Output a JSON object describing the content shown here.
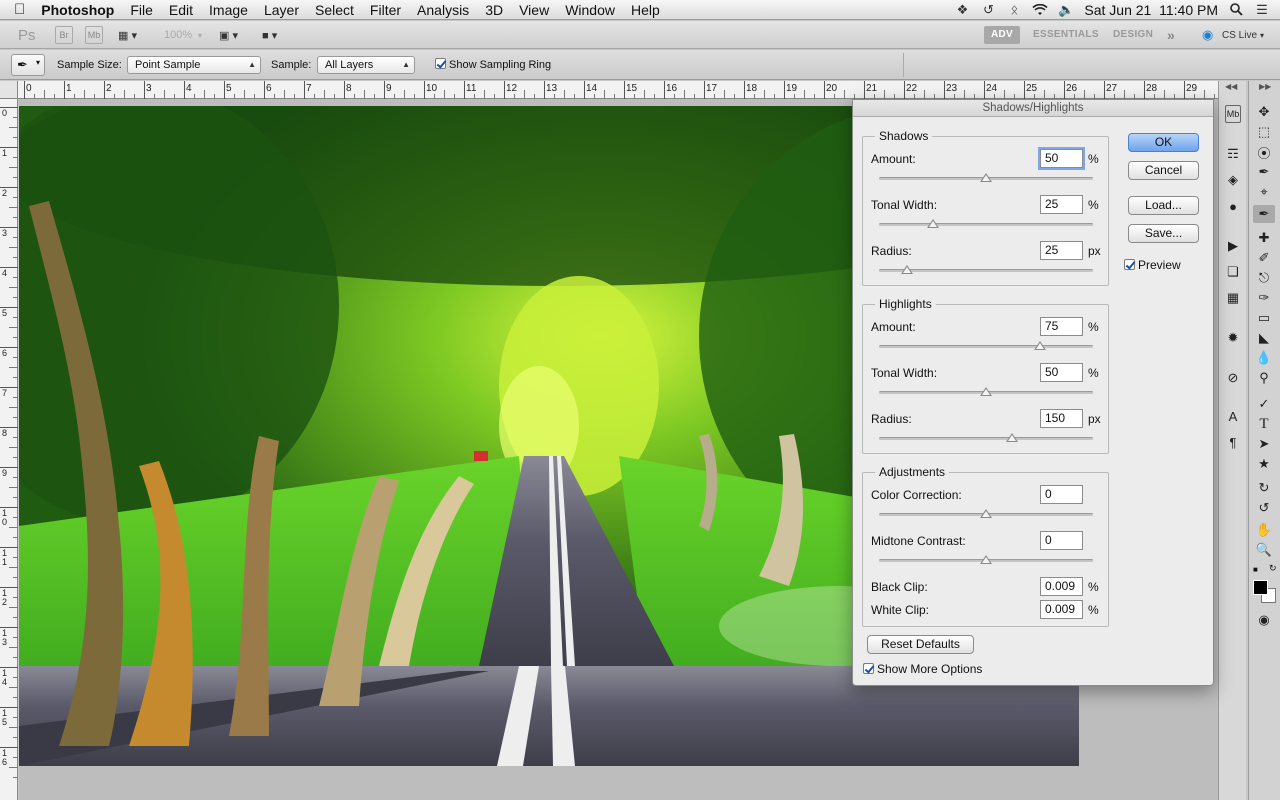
{
  "menubar": {
    "app_name": "Photoshop",
    "menus": [
      "File",
      "Edit",
      "Image",
      "Layer",
      "Select",
      "Filter",
      "Analysis",
      "3D",
      "View",
      "Window",
      "Help"
    ],
    "clock": "Sat Jun 21  11:40 PM",
    "icons": [
      "apple-icon",
      "dropbox-icon",
      "time-machine-icon",
      "bluetooth-icon",
      "wifi-icon",
      "volume-icon",
      "search-icon",
      "list-icon"
    ]
  },
  "appbar": {
    "ps_label": "Ps",
    "br_label": "Br",
    "mb_label": "Mb",
    "zoom": "100%",
    "workspaces": [
      "ADV",
      "ESSENTIALS",
      "DESIGN"
    ],
    "more": "»",
    "cs_live": "CS Live"
  },
  "options": {
    "sample_size_label": "Sample Size:",
    "sample_size_value": "Point Sample",
    "sample_label": "Sample:",
    "sample_value": "All Layers",
    "show_ring_label": "Show Sampling Ring",
    "show_ring_checked": true
  },
  "ruler": {
    "h_numbers": [
      "0",
      "1",
      "2",
      "3",
      "4",
      "5",
      "6",
      "7",
      "8",
      "9",
      "10",
      "11",
      "12",
      "13",
      "14",
      "15",
      "16",
      "17",
      "18",
      "19",
      "20",
      "21",
      "22",
      "23",
      "24",
      "25",
      "26",
      "27",
      "28",
      "29"
    ],
    "v_numbers": [
      "0",
      "1",
      "2",
      "3",
      "4",
      "5",
      "6",
      "7",
      "8",
      "9",
      "10",
      "11",
      "12",
      "13",
      "14",
      "15",
      "16"
    ]
  },
  "dialog": {
    "title": "Shadows/Highlights",
    "shadows": {
      "title": "Shadows",
      "amount_label": "Amount:",
      "amount": "50",
      "amount_unit": "%",
      "amount_pct": 50,
      "tonal_label": "Tonal Width:",
      "tonal": "25",
      "tonal_unit": "%",
      "tonal_pct": 25,
      "radius_label": "Radius:",
      "radius": "25",
      "radius_unit": "px",
      "radius_pct": 13
    },
    "highlights": {
      "title": "Highlights",
      "amount_label": "Amount:",
      "amount": "75",
      "amount_unit": "%",
      "amount_pct": 75,
      "tonal_label": "Tonal Width:",
      "tonal": "50",
      "tonal_unit": "%",
      "tonal_pct": 50,
      "radius_label": "Radius:",
      "radius": "150",
      "radius_unit": "px",
      "radius_pct": 62
    },
    "adjustments": {
      "title": "Adjustments",
      "color_label": "Color Correction:",
      "color": "0",
      "color_pct": 50,
      "midtone_label": "Midtone Contrast:",
      "midtone": "0",
      "midtone_pct": 50,
      "black_label": "Black Clip:",
      "black": "0.009",
      "black_unit": "%",
      "white_label": "White Clip:",
      "white": "0.009",
      "white_unit": "%"
    },
    "ok": "OK",
    "cancel": "Cancel",
    "load": "Load...",
    "save": "Save...",
    "preview_label": "Preview",
    "preview_checked": true,
    "reset": "Reset Defaults",
    "more_options_label": "Show More Options",
    "more_options_checked": true
  },
  "colors": {
    "accent": "#6fa3ec",
    "road": "#4a4a5a",
    "foliage": "#2e8a1e"
  }
}
